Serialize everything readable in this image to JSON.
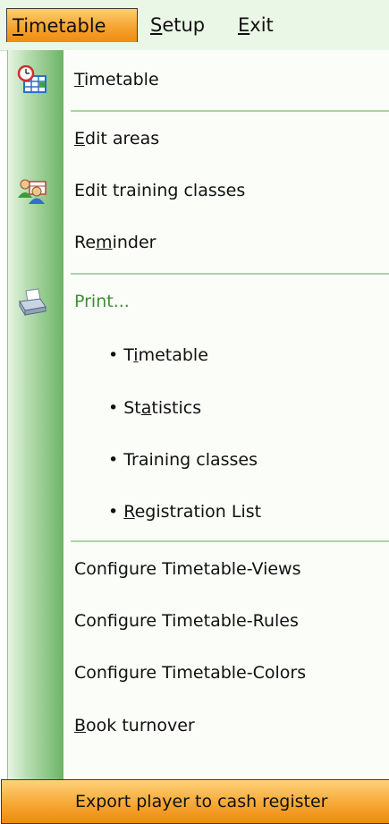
{
  "menubar": {
    "items": [
      {
        "label_u": "T",
        "label_rest": "imetable"
      },
      {
        "label_u": "S",
        "label_rest": "etup"
      },
      {
        "label_u": "E",
        "label_rest": "xit"
      }
    ]
  },
  "dropdown": {
    "timetable": {
      "pre": "",
      "u": "T",
      "post": "imetable",
      "icon": "timetable-clock-grid-icon"
    },
    "edit_areas": {
      "pre": "",
      "u": "E",
      "post": "dit areas"
    },
    "edit_training_classes": {
      "label": "Edit training classes",
      "icon": "people-group-icon"
    },
    "reminder": {
      "pre": "Re",
      "u": "m",
      "post": "inder"
    },
    "print": {
      "label": "Print...",
      "icon": "printer-icon"
    },
    "print_timetable": {
      "pre": "• T",
      "u": "i",
      "post": "metable"
    },
    "print_statistics": {
      "pre": "• St",
      "u": "a",
      "post": "tistics"
    },
    "print_training_classes": {
      "label": "• Training classes"
    },
    "print_registration_list": {
      "pre": "• ",
      "u": "R",
      "post": "egistration List"
    },
    "configure_views": {
      "label": "Configure Timetable-Views"
    },
    "configure_rules": {
      "label": "Configure Timetable-Rules"
    },
    "configure_colors": {
      "label": "Configure Timetable-Colors"
    },
    "book_turnover": {
      "pre": "",
      "u": "B",
      "post": "ook turnover"
    },
    "export_player": {
      "label": "Export player to cash register"
    }
  },
  "colors": {
    "highlight": "#f6a835",
    "gutter": "#6cb465",
    "separator": "#a9d59f",
    "disabled_text": "#3f8f35"
  }
}
